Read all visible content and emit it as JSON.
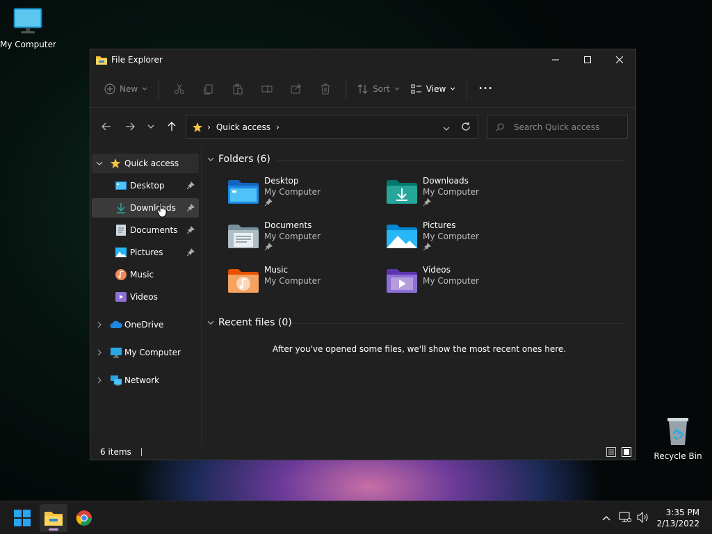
{
  "desktop": {
    "icons": [
      {
        "label": "My Computer",
        "icon": "monitor-icon"
      },
      {
        "label": "Recycle Bin",
        "icon": "recycle-bin-icon"
      }
    ]
  },
  "window": {
    "title": "File Explorer",
    "toolbar": {
      "new_label": "New",
      "sort_label": "Sort",
      "view_label": "View",
      "more_label": "•••"
    },
    "address": {
      "location": "Quick access",
      "separator": "›"
    },
    "search": {
      "placeholder": "Search Quick access"
    },
    "sidebar": {
      "items": [
        {
          "label": "Quick access",
          "icon": "star-icon"
        },
        {
          "label": "Desktop",
          "icon": "desktop-icon"
        },
        {
          "label": "Downloads",
          "icon": "download-icon"
        },
        {
          "label": "Documents",
          "icon": "documents-icon"
        },
        {
          "label": "Pictures",
          "icon": "pictures-icon"
        },
        {
          "label": "Music",
          "icon": "music-icon"
        },
        {
          "label": "Videos",
          "icon": "videos-icon"
        },
        {
          "label": "OneDrive",
          "icon": "cloud-icon"
        },
        {
          "label": "My Computer",
          "icon": "monitor-icon"
        },
        {
          "label": "Network",
          "icon": "network-icon"
        }
      ]
    },
    "content": {
      "folders_header": "Folders (6)",
      "folders": [
        {
          "name": "Desktop",
          "location": "My Computer",
          "pinned": true,
          "color": "#1e88e5"
        },
        {
          "name": "Downloads",
          "location": "My Computer",
          "pinned": true,
          "color": "#26a69a"
        },
        {
          "name": "Documents",
          "location": "My Computer",
          "pinned": true,
          "color": "#90a4ae"
        },
        {
          "name": "Pictures",
          "location": "My Computer",
          "pinned": true,
          "color": "#29b6f6"
        },
        {
          "name": "Music",
          "location": "My Computer",
          "pinned": false,
          "color": "#ef8a5a"
        },
        {
          "name": "Videos",
          "location": "My Computer",
          "pinned": false,
          "color": "#8e6fd8"
        }
      ],
      "recent_header": "Recent files (0)",
      "recent_empty": "After you've opened some files, we'll show the most recent ones here."
    },
    "status": {
      "item_count": "6 items"
    }
  },
  "taskbar": {
    "time": "3:35 PM",
    "date": "2/13/2022"
  }
}
